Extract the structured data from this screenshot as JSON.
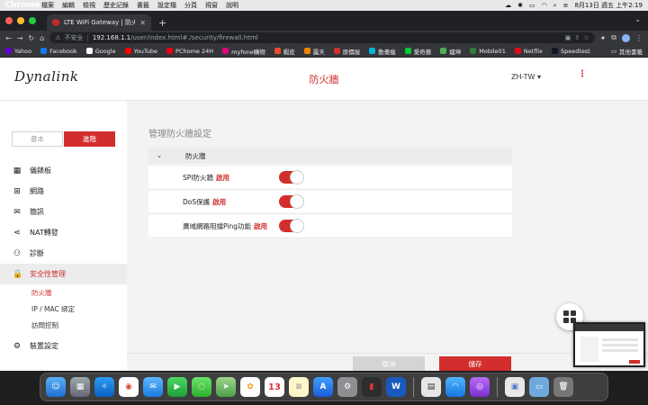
{
  "menubar": {
    "app": "Chrome",
    "items": [
      "檔案",
      "編輯",
      "檢視",
      "歷史記錄",
      "書籤",
      "設定檔",
      "分頁",
      "視窗",
      "說明"
    ],
    "datetime": "8月13日 週五 上午2:19"
  },
  "browser": {
    "tab_title": "LTE WiFi Gateway | 防火牆",
    "new_tab": "+",
    "security": "不安全",
    "url_host": "192.168.1.1",
    "url_path": "/user/index.html#./security/firewall.html",
    "bookmarks": [
      {
        "label": "Yahoo",
        "color": "#6001d2"
      },
      {
        "label": "Facebook",
        "color": "#1877f2"
      },
      {
        "label": "Google",
        "color": "#ffffff"
      },
      {
        "label": "YouTube",
        "color": "#ff0000"
      },
      {
        "label": "PChome 24H",
        "color": "#e60012"
      },
      {
        "label": "myfone購物",
        "color": "#e4007f"
      },
      {
        "label": "蝦皮",
        "color": "#ee4d2d"
      },
      {
        "label": "露天",
        "color": "#f08300"
      },
      {
        "label": "原價屋",
        "color": "#d32f2f"
      },
      {
        "label": "動畫瘋",
        "color": "#00b4d8"
      },
      {
        "label": "愛奇藝",
        "color": "#00cc36"
      },
      {
        "label": "爐坤",
        "color": "#4caf50"
      },
      {
        "label": "Mobile01",
        "color": "#2e7d32"
      },
      {
        "label": "Netflix",
        "color": "#e50914"
      },
      {
        "label": "Speedtest",
        "color": "#141526"
      }
    ],
    "other_bookmarks": "其他書籤"
  },
  "header": {
    "logo": "Dynalink",
    "title": "防火牆",
    "language": "ZH-TW"
  },
  "sidebar": {
    "mode_basic": "基本",
    "mode_advanced": "進階",
    "items": [
      {
        "label": "儀錶板",
        "icon": "▦"
      },
      {
        "label": "網路",
        "icon": "⊞"
      },
      {
        "label": "簡訊",
        "icon": "✉"
      },
      {
        "label": "NAT轉發",
        "icon": "⋖"
      },
      {
        "label": "診斷",
        "icon": "⚇"
      },
      {
        "label": "安全性管理",
        "icon": "🔒"
      },
      {
        "label": "裝置設定",
        "icon": "⚙"
      }
    ],
    "sub_items": [
      "防火牆",
      "IP / MAC 綁定",
      "訪問控制"
    ]
  },
  "main": {
    "section_title": "管理防火牆設定",
    "panel_title": "防火牆",
    "rows": [
      {
        "label": "SPI防火牆",
        "status": "啟用"
      },
      {
        "label": "DoS保護",
        "status": "啟用"
      },
      {
        "label": "廣域網路阻擋Ping功能",
        "status": "啟用"
      }
    ],
    "cancel": "取消",
    "save": "儲存"
  },
  "colors": {
    "accent": "#d22e2e",
    "page_bg": "#f3f3f3"
  }
}
